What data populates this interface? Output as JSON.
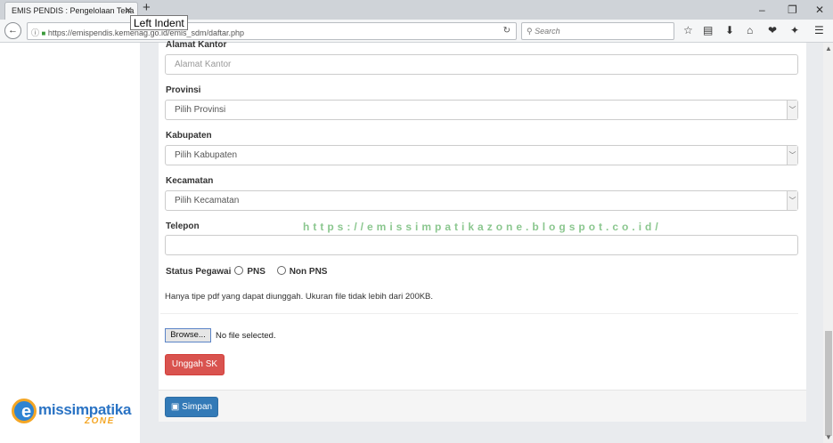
{
  "browser": {
    "tab_title": "EMIS PENDIS : Pengelolaan Tena",
    "tab_close": "✕",
    "new_tab": "+",
    "tooltip": "Left Indent",
    "url": "https://emispendis.kemenag.go.id/emis_sdm/daftar.php",
    "search_placeholder": "Search",
    "reload": "↻",
    "back": "←",
    "win_min": "–",
    "win_max": "❐",
    "win_close": "✕",
    "toolbar": {
      "star": "☆",
      "reading": "▤",
      "download": "⬇",
      "home": "⌂",
      "pocket": "❤",
      "extension": "✦",
      "menu": "☰"
    }
  },
  "logo": {
    "main": "missimpatika",
    "e": "e",
    "sub": "ZONE"
  },
  "form": {
    "alamat_kantor": {
      "label": "Alamat Kantor",
      "placeholder": "Alamat Kantor"
    },
    "provinsi": {
      "label": "Provinsi",
      "value": "Pilih Provinsi"
    },
    "kabupaten": {
      "label": "Kabupaten",
      "value": "Pilih Kabupaten"
    },
    "kecamatan": {
      "label": "Kecamatan",
      "value": "Pilih Kecamatan"
    },
    "telepon": {
      "label": "Telepon",
      "value": ""
    },
    "status": {
      "label": "Status Pegawai",
      "opt1": "PNS",
      "opt2": "Non PNS"
    },
    "note": "Hanya tipe pdf yang dapat diunggah. Ukuran file tidak lebih dari 200KB.",
    "browse": "Browse...",
    "no_file": "No file selected.",
    "upload": "Unggah SK",
    "save": "Simpan"
  },
  "watermark": "https://emissimpatikazone.blogspot.co.id/",
  "icons": {
    "select_arrow": "﹀",
    "scroll_up": "▲",
    "scroll_down": "▼",
    "lock": "🔒",
    "info": "ⓘ",
    "search": "⚲",
    "save": "▣"
  }
}
